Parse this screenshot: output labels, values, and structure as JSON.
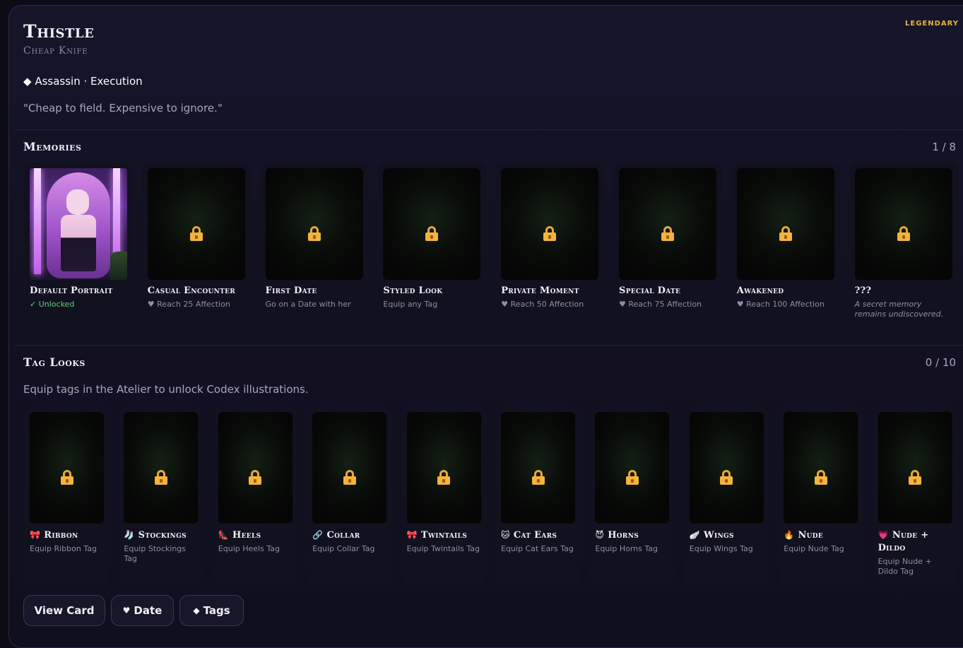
{
  "character": {
    "name": "Thistle",
    "subtitle": "Cheap Knife",
    "rarity": "LEGENDARY",
    "archetype_icon": "◆",
    "archetype": "Assassin · Execution",
    "quote": "\"Cheap to field. Expensive to ignore.\""
  },
  "memories": {
    "title": "Memories",
    "count": "1 / 8",
    "items": [
      {
        "title": "Default Portrait",
        "desc": "✓ Unlocked",
        "icon": "portrait-image"
      },
      {
        "title": "Casual Encounter",
        "desc": "♥ Reach 25 Affection",
        "icon": "lock-icon"
      },
      {
        "title": "First Date",
        "desc": "Go on a Date with her",
        "icon": "lock-icon"
      },
      {
        "title": "Styled Look",
        "desc": "Equip any Tag",
        "icon": "lock-icon"
      },
      {
        "title": "Private Moment",
        "desc": "♥ Reach 50 Affection",
        "icon": "lock-icon"
      },
      {
        "title": "Special Date",
        "desc": "♥ Reach 75 Affection",
        "icon": "lock-icon"
      },
      {
        "title": "Awakened",
        "desc": "♥ Reach 100 Affection",
        "icon": "lock-icon"
      },
      {
        "title": "???",
        "desc": "A secret memory remains undiscovered.",
        "icon": "lock-icon"
      }
    ]
  },
  "tag_looks": {
    "title": "Tag Looks",
    "count": "0 / 10",
    "hint": "Equip tags in the Atelier to unlock Codex illustrations.",
    "items": [
      {
        "icon": "🎀",
        "title": "Ribbon",
        "desc": "Equip Ribbon Tag"
      },
      {
        "icon": "🧦",
        "title": "Stockings",
        "desc": "Equip Stockings Tag"
      },
      {
        "icon": "👠",
        "title": "Heels",
        "desc": "Equip Heels Tag"
      },
      {
        "icon": "🔗",
        "title": "Collar",
        "desc": "Equip Collar Tag"
      },
      {
        "icon": "🎀",
        "title": "Twintails",
        "desc": "Equip Twintails Tag"
      },
      {
        "icon": "🐱",
        "title": "Cat Ears",
        "desc": "Equip Cat Ears Tag"
      },
      {
        "icon": "😈",
        "title": "Horns",
        "desc": "Equip Horns Tag"
      },
      {
        "icon": "🪽",
        "title": "Wings",
        "desc": "Equip Wings Tag"
      },
      {
        "icon": "🔥",
        "title": "Nude",
        "desc": "Equip Nude Tag"
      },
      {
        "icon": "💗",
        "title": "Nude + Dildo",
        "desc": "Equip Nude + Dildo Tag"
      }
    ]
  },
  "buttons": {
    "view_card": "View Card",
    "date_icon": "♥",
    "date": "Date",
    "tags_icon": "◆",
    "tags": "Tags"
  },
  "colors": {
    "rarity": "#e8b541",
    "unlocked": "#5fd07a",
    "lock": "#f4b43c",
    "accent_border": "#3a3754"
  }
}
